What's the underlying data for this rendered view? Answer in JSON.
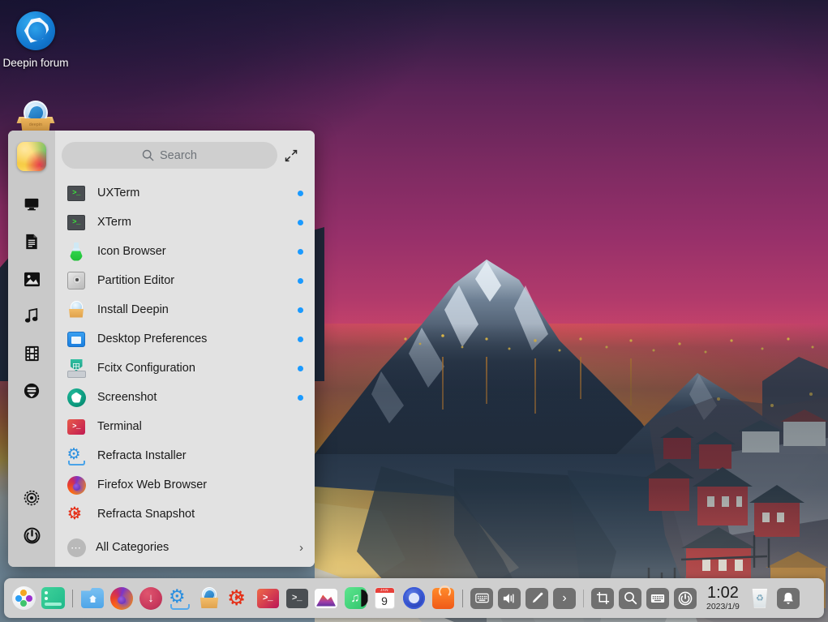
{
  "desktop": {
    "icons": [
      {
        "name": "Deepin forum",
        "icon": "deepin-forum-icon"
      },
      {
        "name": "deepin",
        "icon": "install-deepin-box-icon"
      }
    ]
  },
  "launcher": {
    "search": {
      "placeholder": "Search",
      "value": "",
      "icon": "search-icon"
    },
    "expand_icon": "fullscreen-expand-icon",
    "sidebar": {
      "avatar_icon": "user-avatar",
      "categories": [
        {
          "name": "internet-category",
          "icon": "monitor-icon",
          "glyph": "🖥"
        },
        {
          "name": "office-category",
          "icon": "document-icon",
          "glyph": "🗎"
        },
        {
          "name": "graphics-category",
          "icon": "image-icon",
          "glyph": "🖼"
        },
        {
          "name": "music-category",
          "icon": "music-note-icon",
          "glyph": "♫"
        },
        {
          "name": "video-category",
          "icon": "film-icon",
          "glyph": "🎞"
        },
        {
          "name": "system-category",
          "icon": "disk-icon",
          "glyph": "⛃"
        }
      ],
      "bottom": [
        {
          "name": "settings-button",
          "icon": "settings-gear-icon",
          "glyph": "⚙"
        },
        {
          "name": "power-button",
          "icon": "power-icon",
          "glyph": "⏻"
        }
      ]
    },
    "apps": [
      {
        "label": "UXTerm",
        "icon": "uxterm-icon",
        "dot": true
      },
      {
        "label": "XTerm",
        "icon": "xterm-icon",
        "dot": true
      },
      {
        "label": "Icon Browser",
        "icon": "icon-browser-icon",
        "dot": true
      },
      {
        "label": "Partition Editor",
        "icon": "partition-editor-icon",
        "dot": true
      },
      {
        "label": "Install Deepin",
        "icon": "install-deepin-icon",
        "dot": true
      },
      {
        "label": "Desktop Preferences",
        "icon": "desktop-preferences-icon",
        "dot": true
      },
      {
        "label": "Fcitx Configuration",
        "icon": "fcitx-configuration-icon",
        "dot": true
      },
      {
        "label": "Screenshot",
        "icon": "screenshot-icon",
        "dot": true
      },
      {
        "label": "Terminal",
        "icon": "terminal-icon",
        "dot": false
      },
      {
        "label": "Refracta Installer",
        "icon": "refracta-installer-icon",
        "dot": false
      },
      {
        "label": "Firefox Web Browser",
        "icon": "firefox-icon",
        "dot": false
      },
      {
        "label": "Refracta Snapshot",
        "icon": "refracta-snapshot-icon",
        "dot": false
      }
    ],
    "all_categories": {
      "label": "All Categories",
      "icon": "ellipsis-icon",
      "chevron": "›"
    }
  },
  "dock": {
    "apps": [
      {
        "name": "launcher-button",
        "tooltip": "Launcher"
      },
      {
        "name": "show-desktop-button",
        "tooltip": "Show Desktop"
      },
      {
        "name": "file-manager-button",
        "tooltip": "File Manager"
      },
      {
        "name": "firefox-button",
        "tooltip": "Firefox Web Browser"
      },
      {
        "name": "downloader-button",
        "tooltip": "Downloader"
      },
      {
        "name": "refracta-installer-button",
        "tooltip": "Refracta Installer"
      },
      {
        "name": "install-deepin-button",
        "tooltip": "Install Deepin"
      },
      {
        "name": "refracta-snapshot-button",
        "tooltip": "Refracta Snapshot"
      },
      {
        "name": "terminal-button",
        "tooltip": "Terminal"
      },
      {
        "name": "xterm-button",
        "tooltip": "XTerm"
      },
      {
        "name": "image-viewer-button",
        "tooltip": "Image Viewer"
      },
      {
        "name": "music-player-button",
        "tooltip": "Music"
      },
      {
        "name": "calendar-button",
        "tooltip": "Calendar"
      },
      {
        "name": "control-center-button",
        "tooltip": "Control Center"
      },
      {
        "name": "app-store-button",
        "tooltip": "App Store"
      }
    ],
    "calendar_day": "9",
    "calendar_month": "JAN",
    "tray": [
      {
        "name": "input-method-tray-icon",
        "glyph": "⌨"
      },
      {
        "name": "volume-tray-icon",
        "glyph": "🔊"
      },
      {
        "name": "color-picker-tray-icon",
        "glyph": "✒"
      },
      {
        "name": "tray-expand-icon",
        "glyph": "›"
      }
    ],
    "plugins": [
      {
        "name": "screenshot-plugin-icon",
        "glyph": "⌗"
      },
      {
        "name": "search-plugin-icon",
        "glyph": "🔍"
      },
      {
        "name": "onboard-keyboard-plugin-icon",
        "glyph": "⌨"
      },
      {
        "name": "shutdown-plugin-icon",
        "glyph": "⏻"
      }
    ],
    "clock": {
      "time": "1:02",
      "date": "2023/1/9"
    },
    "trash": {
      "name": "trash-icon",
      "glyph": "♻"
    },
    "notification": {
      "name": "notification-bell-icon",
      "glyph": "🔔"
    }
  },
  "colors": {
    "accent_blue": "#1a9aff",
    "panel_bg": "#e2e2e2",
    "sidebar_bg": "#c9c9c9",
    "dock_bg": "#cfcfcf",
    "search_bg": "#cfcfcf"
  }
}
